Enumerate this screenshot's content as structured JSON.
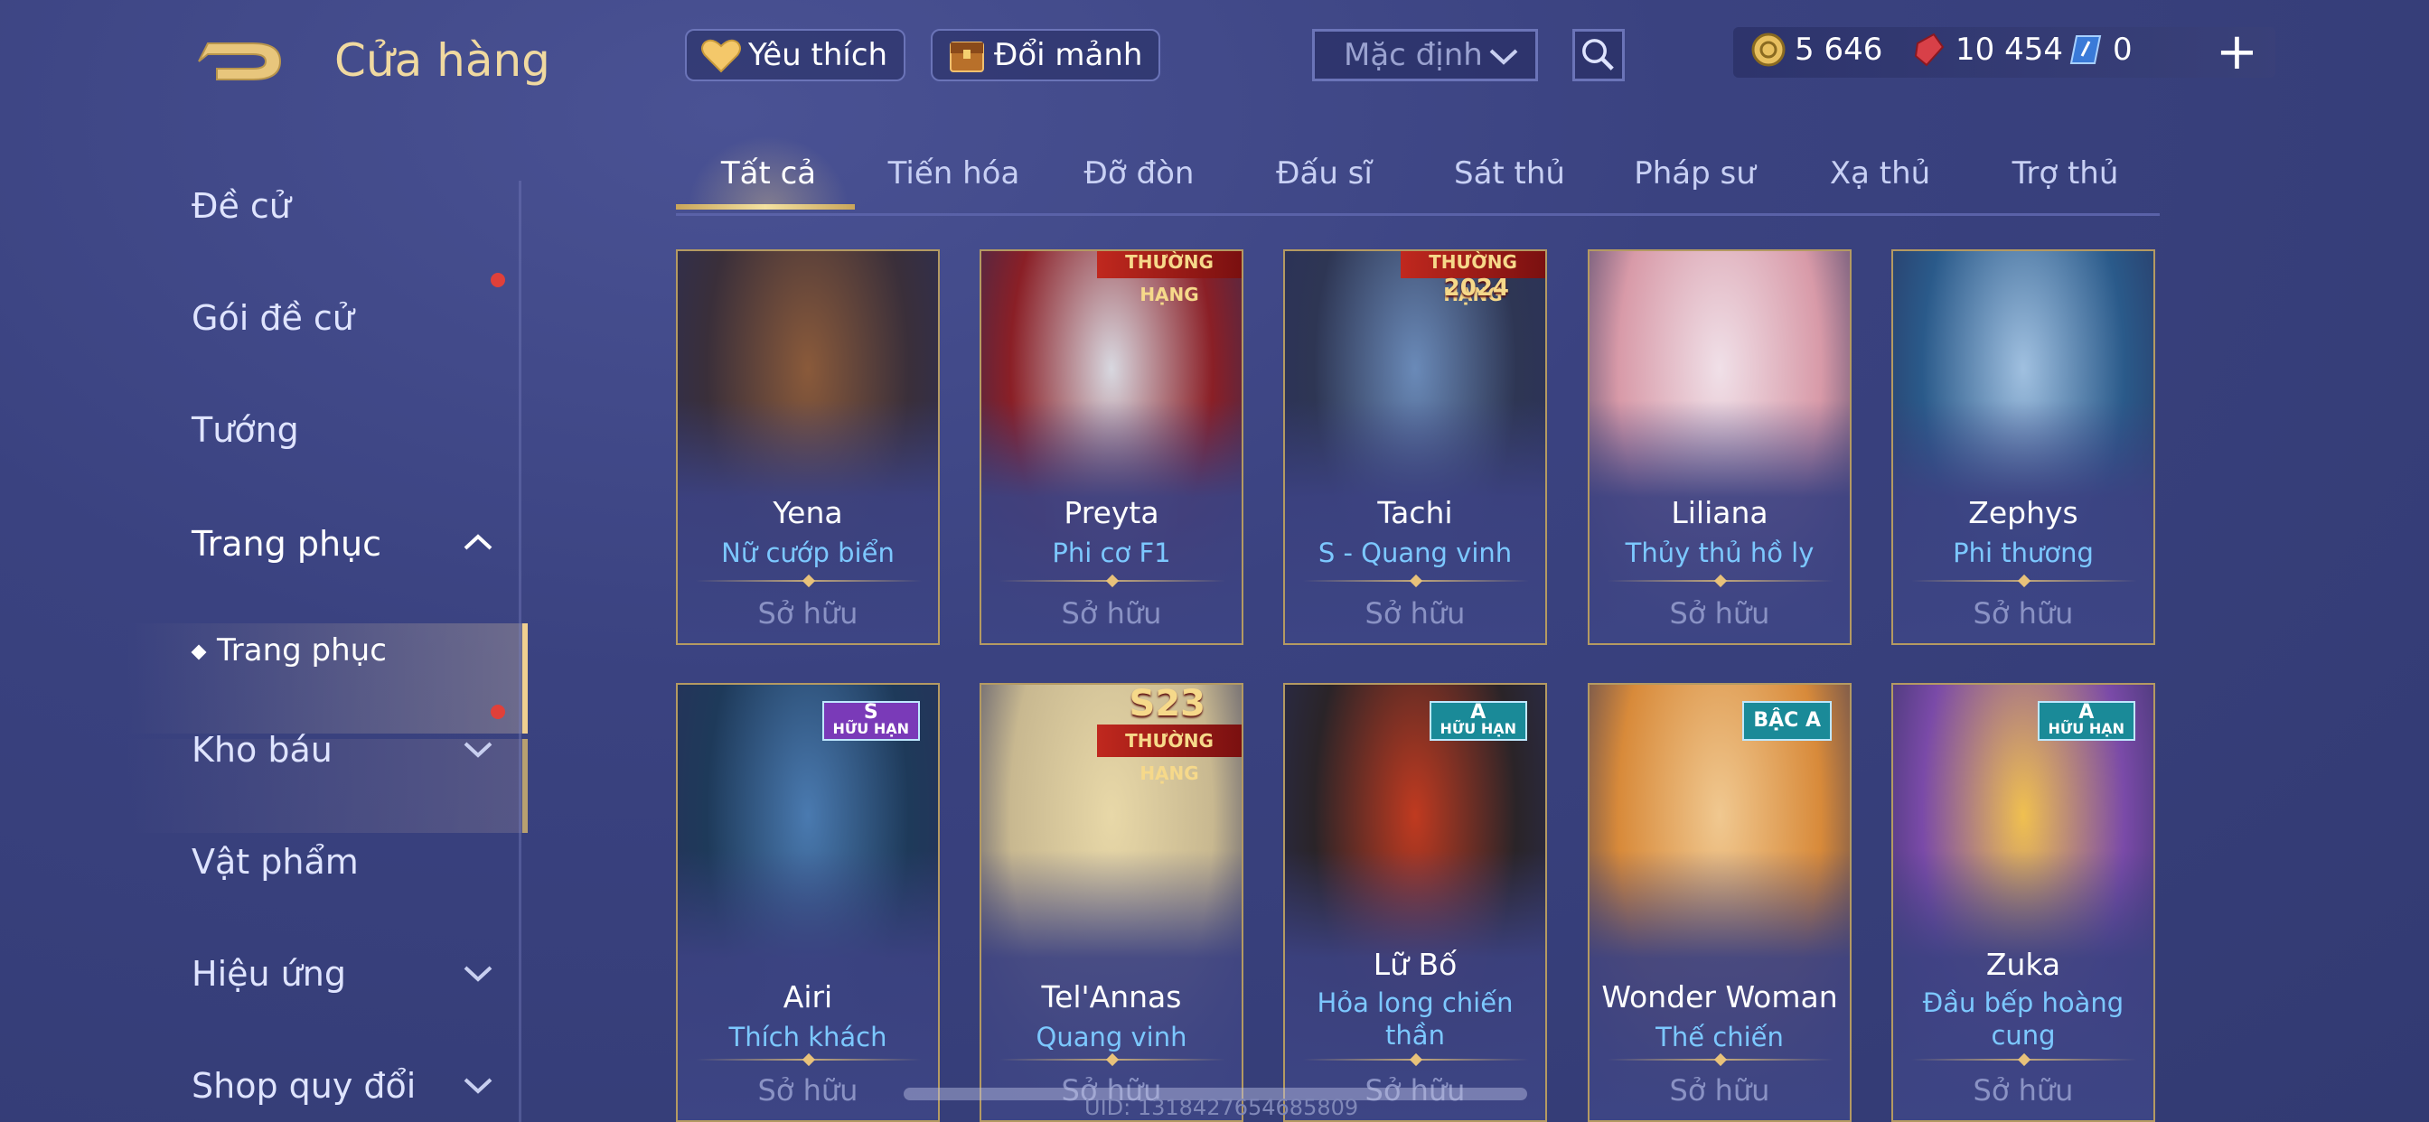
{
  "header": {
    "title": "Cửa hàng",
    "favorite_label": "Yêu thích",
    "exchange_label": "Đổi mảnh",
    "sort_selected": "Mặc định",
    "currencies": [
      {
        "name": "gold",
        "value": "5 646"
      },
      {
        "name": "voucher",
        "value": "10 454"
      },
      {
        "name": "coupon",
        "value": "0"
      }
    ],
    "plus_label": "+"
  },
  "sidebar": {
    "items": [
      {
        "label": "Đề cử"
      },
      {
        "label": "Gói đề cử"
      },
      {
        "label": "Tướng"
      },
      {
        "label": "Trang phục"
      },
      {
        "label": "Trang phục"
      },
      {
        "label": "Kho báu"
      },
      {
        "label": "Vật phẩm"
      },
      {
        "label": "Hiệu ứng"
      },
      {
        "label": "Shop quy đổi"
      }
    ]
  },
  "tabs": [
    "Tất cả",
    "Tiến hóa",
    "Đỡ đòn",
    "Đấu sĩ",
    "Sát thủ",
    "Pháp sư",
    "Xạ thủ",
    "Trợ thủ"
  ],
  "cards": [
    {
      "hero": "Yena",
      "skin": "Nữ cướp biển",
      "status": "Sở hữu",
      "art": "#3a2f3a",
      "accent": "#8a5a3a"
    },
    {
      "hero": "Preyta",
      "skin": "Phi cơ F1",
      "status": "Sở hữu",
      "art": "#8a1f26",
      "accent": "#d8d8e0",
      "rank_label": "THƯỜNG HẠNG"
    },
    {
      "hero": "Tachi",
      "skin": "S - Quang vinh",
      "status": "Sở hữu",
      "art": "#2e3654",
      "accent": "#6a8ab8",
      "rank_label": "THƯỜNG HẠNG",
      "season_label": "2024"
    },
    {
      "hero": "Liliana",
      "skin": "Thủy thủ hồ ly",
      "status": "Sở hữu",
      "art": "#d89aa8",
      "accent": "#f0e0e8"
    },
    {
      "hero": "Zephys",
      "skin": "Phi thương",
      "status": "Sở hữu",
      "art": "#2a5a8a",
      "accent": "#a0c0e0"
    },
    {
      "hero": "Airi",
      "skin": "Thích khách",
      "status": "Sở hữu",
      "art": "#1e3a5a",
      "accent": "#4a7ab0",
      "badge_top": "S",
      "badge_bottom": "HỮU HẠN",
      "badge_color": "#7a3ab8"
    },
    {
      "hero": "Tel'Annas",
      "skin": "Quang vinh",
      "status": "Sở hữu",
      "art": "#c8b890",
      "accent": "#e8d8a8",
      "rank_label": "THƯỜNG HẠNG",
      "season_label": "S23"
    },
    {
      "hero": "Lữ Bố",
      "skin": "Hỏa long chiến thần",
      "status": "Sở hữu",
      "art": "#2a2428",
      "accent": "#c03a20",
      "badge_top": "A",
      "badge_bottom": "HỮU HẠN",
      "badge_color": "#1a8a98"
    },
    {
      "hero": "Wonder Woman",
      "skin": "Thế chiến",
      "status": "Sở hữu",
      "art": "#d88a3a",
      "accent": "#f0c890",
      "badge_top": "BẬC A",
      "badge_bottom": "",
      "badge_color": "#1a8a98"
    },
    {
      "hero": "Zuka",
      "skin": "Đầu bếp hoàng cung",
      "status": "Sở hữu",
      "art": "#7a4aa8",
      "accent": "#f0c050",
      "badge_top": "A",
      "badge_bottom": "HỮU HẠN",
      "badge_color": "#1a8a98"
    }
  ],
  "footer": {
    "uid": "UID: 1318427654685809"
  },
  "colors": {
    "gold": "#f0d9a0",
    "skin_name": "#7cc8ff",
    "accent_line": "#f0d090"
  }
}
